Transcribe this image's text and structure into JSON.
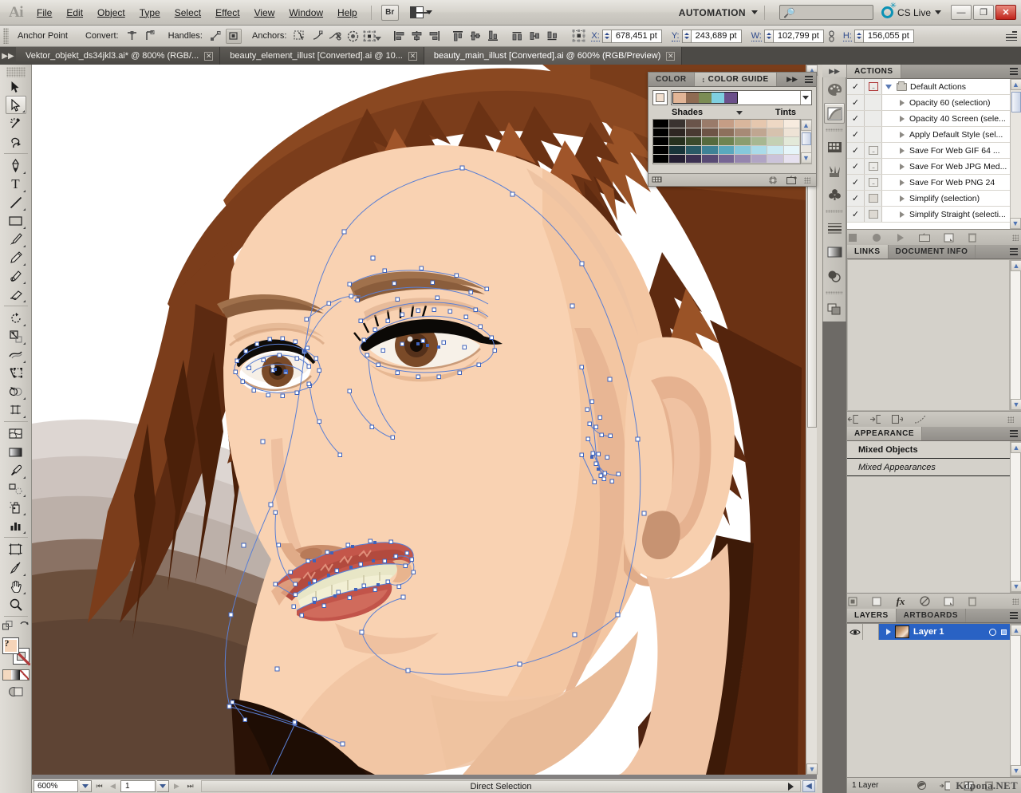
{
  "app": {
    "logo": "Ai",
    "menus": [
      "File",
      "Edit",
      "Object",
      "Type",
      "Select",
      "Effect",
      "View",
      "Window",
      "Help"
    ],
    "bridge_label": "Br",
    "workspace": "AUTOMATION",
    "search_placeholder": "",
    "cslive_label": "CS Live",
    "window_buttons": {
      "minimize": "—",
      "restore": "❐",
      "close": "✕"
    }
  },
  "control_bar": {
    "context_label": "Anchor Point",
    "convert_label": "Convert:",
    "handles_label": "Handles:",
    "anchors_label": "Anchors:",
    "fields": [
      {
        "label": "X:",
        "value": "678,451 pt"
      },
      {
        "label": "Y:",
        "value": "243,689 pt"
      },
      {
        "label": "W:",
        "value": "102,799 pt"
      },
      {
        "label": "H:",
        "value": "156,055 pt"
      }
    ]
  },
  "tabs": [
    {
      "title": "Vektor_objekt_ds34jkl3.ai* @ 800% (RGB/...",
      "active": false,
      "close": "✕"
    },
    {
      "title": "beauty_element_illust [Converted].ai @ 10...",
      "active": false,
      "close": "✕"
    },
    {
      "title": "beauty_main_illust [Converted].ai @ 600% (RGB/Preview)",
      "active": true,
      "close": "✕"
    }
  ],
  "toolbar": {
    "tools": [
      {
        "name": "selection-tool",
        "active": false
      },
      {
        "name": "direct-selection-tool",
        "active": true
      },
      {
        "name": "magic-wand-tool",
        "active": false
      },
      {
        "name": "lasso-tool",
        "active": false
      },
      {
        "name": "pen-tool",
        "active": false
      },
      {
        "name": "type-tool",
        "active": false
      },
      {
        "name": "line-segment-tool",
        "active": false
      },
      {
        "name": "rectangle-tool",
        "active": false
      },
      {
        "name": "paintbrush-tool",
        "active": false
      },
      {
        "name": "pencil-tool",
        "active": false
      },
      {
        "name": "blob-brush-tool",
        "active": false
      },
      {
        "name": "eraser-tool",
        "active": false
      },
      {
        "name": "rotate-tool",
        "active": false
      },
      {
        "name": "scale-tool",
        "active": false
      },
      {
        "name": "width-tool",
        "active": false
      },
      {
        "name": "free-transform-tool",
        "active": false
      },
      {
        "name": "shape-builder-tool",
        "active": false
      },
      {
        "name": "perspective-grid-tool",
        "active": false
      },
      {
        "name": "mesh-tool",
        "active": false
      },
      {
        "name": "gradient-tool",
        "active": false
      },
      {
        "name": "eyedropper-tool",
        "active": false
      },
      {
        "name": "blend-tool",
        "active": false
      },
      {
        "name": "symbol-sprayer-tool",
        "active": false
      },
      {
        "name": "column-graph-tool",
        "active": false
      },
      {
        "name": "artboard-tool",
        "active": false
      },
      {
        "name": "slice-tool",
        "active": false
      },
      {
        "name": "hand-tool",
        "active": false
      },
      {
        "name": "zoom-tool",
        "active": false
      }
    ],
    "fill_color": "#f6d4b8",
    "stroke_color": "#ffffff"
  },
  "color_guide": {
    "tab_color": "COLOR",
    "tab_color_guide": "COLOR GUIDE",
    "shades_label": "Shades",
    "tints_label": "Tints",
    "base_swatches": [
      "#e2b596",
      "#8f6b52",
      "#7b8c54",
      "#7fcfe0",
      "#6b4f8a"
    ],
    "grid_rows": [
      [
        "#000000",
        "#3a3330",
        "#6a544a",
        "#9a7b6a",
        "#c59d85",
        "#d9b69c",
        "#e6c7ae",
        "#eed8c4",
        "#f7ebdf"
      ],
      [
        "#000000",
        "#2e2622",
        "#4a3a32",
        "#6e5446",
        "#8d705c",
        "#a78a76",
        "#c0a691",
        "#d6c2ae",
        "#eee3d6"
      ],
      [
        "#000000",
        "#26301e",
        "#3c4a2c",
        "#566a3e",
        "#6f8452",
        "#8b9d70",
        "#a7b791",
        "#c4d0b4",
        "#e3e9d9"
      ],
      [
        "#000000",
        "#18343a",
        "#2a5a66",
        "#3f8296",
        "#5aa8be",
        "#86c8db",
        "#aadbe9",
        "#cbe9f2",
        "#e6f5f9"
      ],
      [
        "#000000",
        "#241e33",
        "#3c3152",
        "#584a74",
        "#766594",
        "#9585ae",
        "#b0a4c4",
        "#cbc3da",
        "#e6e1ef"
      ]
    ]
  },
  "actions_panel": {
    "title": "ACTIONS",
    "set_name": "Default Actions",
    "items": [
      {
        "label": "Opacity 60 (selection)",
        "checked": true,
        "dialog": "none"
      },
      {
        "label": "Opacity 40 Screen (sele...",
        "checked": true,
        "dialog": "none"
      },
      {
        "label": "Apply Default Style (sel...",
        "checked": true,
        "dialog": "none"
      },
      {
        "label": "Save For Web GIF 64 ...",
        "checked": true,
        "dialog": "on"
      },
      {
        "label": "Save For Web JPG Med...",
        "checked": true,
        "dialog": "on"
      },
      {
        "label": "Save For Web PNG 24",
        "checked": true,
        "dialog": "on"
      },
      {
        "label": "Simplify (selection)",
        "checked": true,
        "dialog": "off"
      },
      {
        "label": "Simplify Straight (selecti...",
        "checked": true,
        "dialog": "off"
      }
    ],
    "footer_icons": [
      "stop-icon",
      "record-icon",
      "play-icon",
      "new-set-icon",
      "new-action-icon",
      "delete-icon"
    ]
  },
  "links_panel": {
    "tab_links": "LINKS",
    "tab_document_info": "DOCUMENT INFO",
    "footer_icons": [
      "relink-icon",
      "goto-link-icon",
      "update-link-icon",
      "edit-original-icon"
    ]
  },
  "appearance_panel": {
    "title": "APPEARANCE",
    "rows": [
      {
        "text": "Mixed Objects",
        "style": "bold"
      },
      {
        "text": "Mixed Appearances",
        "style": "italic"
      }
    ],
    "footer_icons": [
      "add-new-stroke-icon",
      "add-new-fill-icon",
      "add-new-effect-icon",
      "clear-appearance-icon",
      "duplicate-item-icon",
      "delete-item-icon"
    ]
  },
  "layers_panel": {
    "tab_layers": "LAYERS",
    "tab_artboards": "ARTBOARDS",
    "layers": [
      {
        "name": "Layer 1",
        "visible": true,
        "locked": false,
        "selected": true
      }
    ],
    "footer_count": "1 Layer",
    "footer_icons": [
      "make-clipping-mask-icon",
      "create-new-sublayer-icon",
      "create-new-layer-icon",
      "delete-selection-icon"
    ]
  },
  "status_bar": {
    "zoom": "600%",
    "page": "1",
    "tool_status": "Direct Selection"
  },
  "watermark": "Kdpona.NET",
  "artwork": {
    "description": "vector illustration of a woman's face in three-quarter view with auburn hair, open mouth showing teeth, and visible bezier anchor points from Direct Selection",
    "colors": {
      "skin": "#f8d0b0",
      "skin_shadow": "#e8b694",
      "skin_deep": "#d49a78",
      "hair_base": "#8b4a22",
      "hair_mid": "#a55a2a",
      "hair_dark": "#5a2a12",
      "hair_darkest": "#3a1808",
      "lips": "#c4564a",
      "lips_dark": "#a6453c",
      "teeth": "#e8e4c4",
      "eye_iris": "#7a4a28",
      "eye_pupil": "#1a1008",
      "eye_white": "#f4efe6",
      "bg_grey1": "#ddd6d2",
      "bg_grey2": "#c9bfba",
      "bg_grey3": "#b3a79f",
      "bg_brown": "#6b4a32",
      "path_blue": "#5a7fd4",
      "anchor_fill": "#ffffff"
    }
  }
}
